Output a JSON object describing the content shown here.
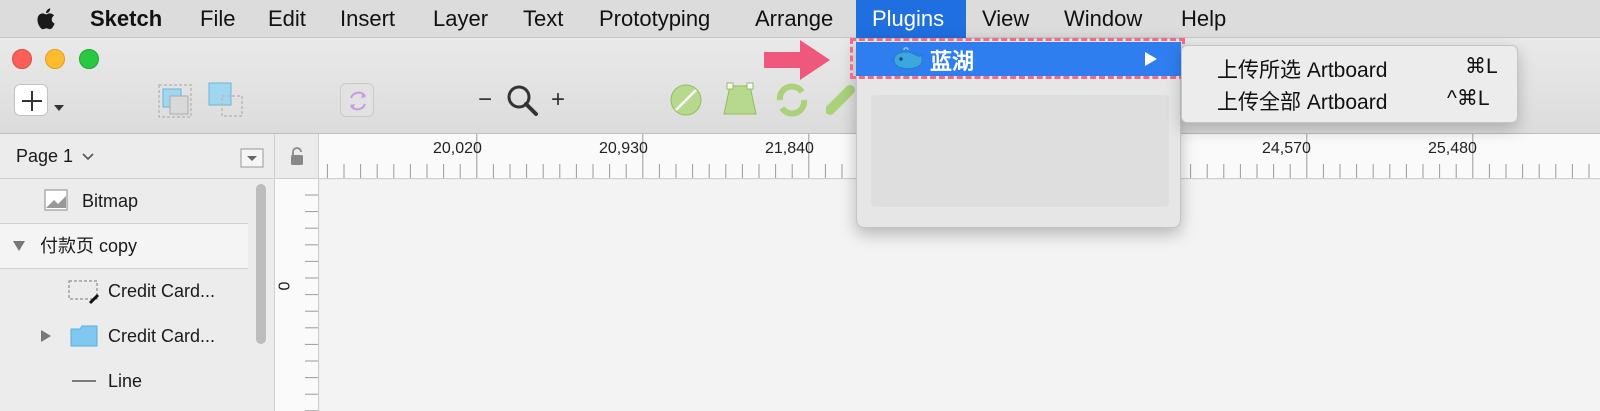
{
  "menubar": {
    "app": "Sketch",
    "items": [
      "File",
      "Edit",
      "Insert",
      "Layer",
      "Text",
      "Prototyping",
      "Arrange",
      "Plugins",
      "View",
      "Window",
      "Help"
    ],
    "active": "Plugins"
  },
  "toolbar": {
    "zoom_minus": "−",
    "zoom_plus": "+"
  },
  "sidebar": {
    "page_selector": "Page 1",
    "layers": [
      {
        "label": "Bitmap",
        "icon": "image-icon"
      },
      {
        "label": "付款页 copy",
        "icon": "disclosure-open-icon"
      },
      {
        "label": "Credit Card...",
        "icon": "symbol-icon"
      },
      {
        "label": "Credit Card...",
        "icon": "folder-icon"
      },
      {
        "label": "Line",
        "icon": "line-icon"
      }
    ]
  },
  "ruler": {
    "h_labels": [
      "20,020",
      "20,930",
      "21,840",
      "24,570",
      "25,480"
    ],
    "v_label": "0"
  },
  "plugins_menu": {
    "plugin_name": "蓝湖",
    "submenu": [
      {
        "label": "上传所选 Artboard",
        "shortcut": "⌘L"
      },
      {
        "label": "上传全部 Artboard",
        "shortcut": "^⌘L"
      }
    ]
  },
  "colors": {
    "menu_highlight": "#1f6fe0",
    "annotation_pink": "#f06a8c",
    "annotation_arrow": "#f0577d"
  }
}
